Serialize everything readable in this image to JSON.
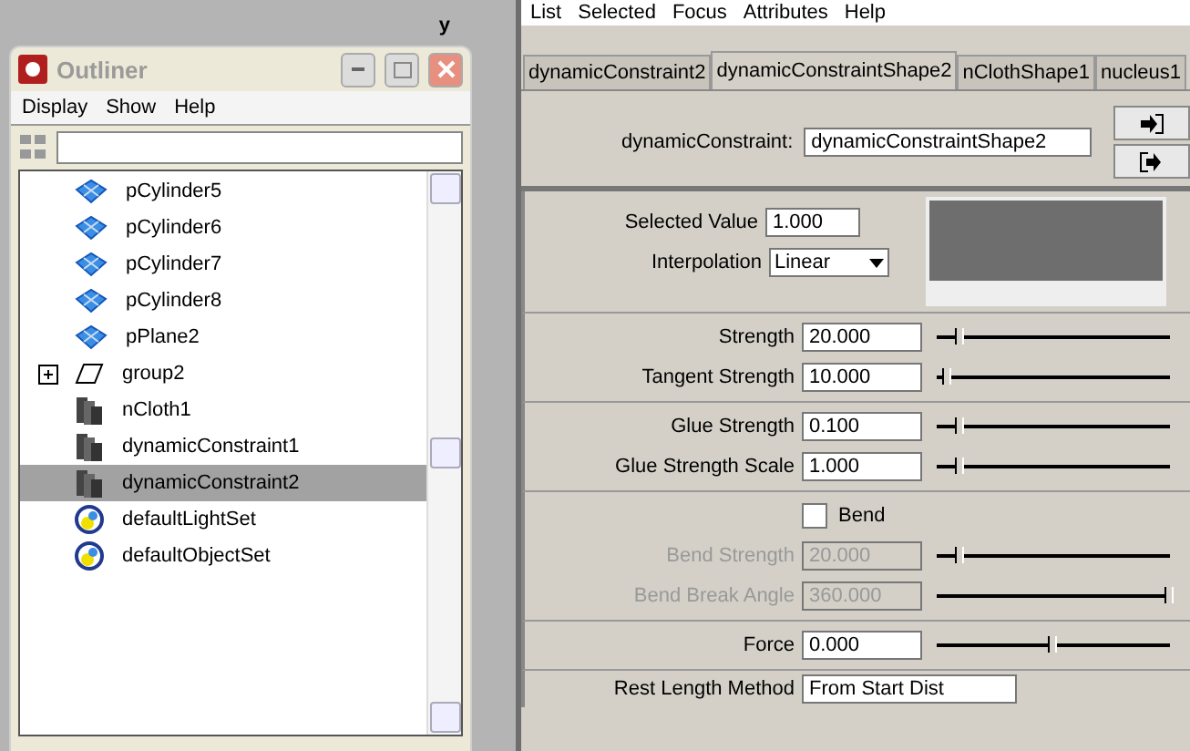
{
  "viewport": {
    "axis_label": "y"
  },
  "outliner": {
    "title": "Outliner",
    "menu": [
      "Display",
      "Show",
      "Help"
    ],
    "items": [
      {
        "label": "pCylinder5",
        "kind": "mesh",
        "selected": false
      },
      {
        "label": "pCylinder6",
        "kind": "mesh",
        "selected": false
      },
      {
        "label": "pCylinder7",
        "kind": "mesh",
        "selected": false
      },
      {
        "label": "pCylinder8",
        "kind": "mesh",
        "selected": false
      },
      {
        "label": "pPlane2",
        "kind": "mesh",
        "selected": false
      },
      {
        "label": "group2",
        "kind": "group",
        "selected": false,
        "expanded": false
      },
      {
        "label": "nCloth1",
        "kind": "cloth",
        "selected": false
      },
      {
        "label": "dynamicConstraint1",
        "kind": "cloth",
        "selected": false
      },
      {
        "label": "dynamicConstraint2",
        "kind": "cloth",
        "selected": true
      },
      {
        "label": "defaultLightSet",
        "kind": "set",
        "selected": false
      },
      {
        "label": "defaultObjectSet",
        "kind": "set",
        "selected": false
      }
    ]
  },
  "attribute_editor": {
    "menu": [
      "List",
      "Selected",
      "Focus",
      "Attributes",
      "Help"
    ],
    "tabs": [
      {
        "label": "dynamicConstraint2",
        "selected": false
      },
      {
        "label": "dynamicConstraintShape2",
        "selected": true
      },
      {
        "label": "nClothShape1",
        "selected": false
      },
      {
        "label": "nucleus1",
        "selected": false
      }
    ],
    "node_label": "dynamicConstraint:",
    "node_value": "dynamicConstraintShape2",
    "selected_value": {
      "label": "Selected Value",
      "value": "1.000"
    },
    "interpolation": {
      "label": "Interpolation",
      "value": "Linear"
    },
    "groups": [
      [
        {
          "label": "Strength",
          "value": "20.000",
          "level": 0.1,
          "disabled": false
        },
        {
          "label": "Tangent Strength",
          "value": "10.000",
          "level": 0.05,
          "disabled": false
        }
      ],
      [
        {
          "label": "Glue Strength",
          "value": "0.100",
          "level": 0.1,
          "disabled": false
        },
        {
          "label": "Glue Strength Scale",
          "value": "1.000",
          "level": 0.1,
          "disabled": false
        }
      ],
      [
        {
          "kind": "checkbox",
          "label": "Bend",
          "checked": false
        },
        {
          "label": "Bend Strength",
          "value": "20.000",
          "level": 0.1,
          "disabled": true
        },
        {
          "label": "Bend Break Angle",
          "value": "360.000",
          "level": 1,
          "disabled": true
        }
      ],
      [
        {
          "label": "Force",
          "value": "0.000",
          "level": 0.5,
          "disabled": false
        }
      ]
    ],
    "rest_length": {
      "label": "Rest Length Method",
      "value": "From Start Dist"
    }
  }
}
